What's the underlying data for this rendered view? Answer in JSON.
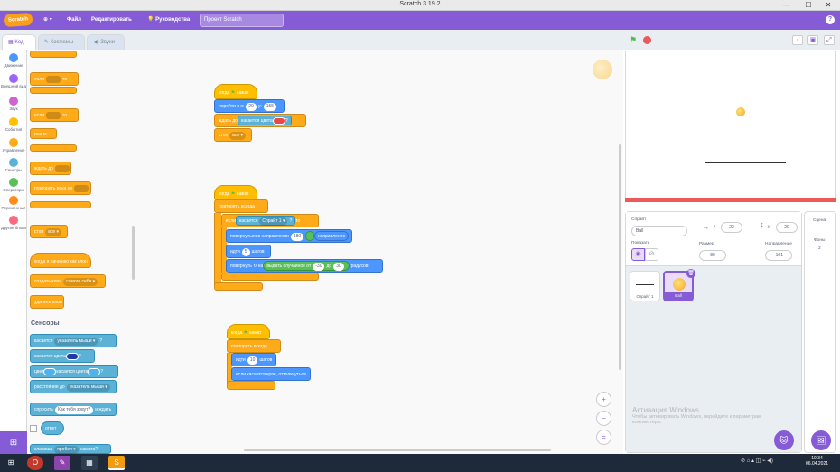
{
  "window": {
    "title": "Scratch 3.19.2",
    "min": "—",
    "max": "☐",
    "close": "✕"
  },
  "menu": {
    "logo": "Scratch",
    "globe": "⊕ ▾",
    "file": "Файл",
    "edit": "Редактировать",
    "tutorials": "Руководства",
    "project_name": "Проект Scratch",
    "help": "?"
  },
  "tabs": {
    "code": "Код",
    "costumes": "Костюмы",
    "sounds": "Звуки"
  },
  "categories": [
    {
      "label": "Движение",
      "color": "#4c97ff"
    },
    {
      "label": "Внешний вид",
      "color": "#9966ff"
    },
    {
      "label": "Звук",
      "color": "#cf63cf"
    },
    {
      "label": "События",
      "color": "#ffbf00"
    },
    {
      "label": "Управление",
      "color": "#ffab19"
    },
    {
      "label": "Сенсоры",
      "color": "#5cb1d6"
    },
    {
      "label": "Операторы",
      "color": "#59c059"
    },
    {
      "label": "Переменные",
      "color": "#ff8c1a"
    },
    {
      "label": "Другие блоки",
      "color": "#ff6680"
    }
  ],
  "palette": {
    "if_then_if": "если",
    "if_then_then": "то",
    "if_else_if": "если",
    "if_else_then": "то",
    "if_else_else": "иначе",
    "wait_until": "ждать до",
    "repeat_until": "повторять пока не",
    "stop": "стоп",
    "stop_opt": "все ▾",
    "clone_start": "когда я начинаю как клон",
    "create_clone": "создать клон",
    "create_clone_opt": "самого себя ▾",
    "delete_clone": "удалить клон",
    "sensing_header": "Сенсоры",
    "touching": "касается",
    "touching_opt": "указатель мыши ▾",
    "touching_q": "?",
    "touching_color": "касается цвета",
    "touching_color_q": "?",
    "color": "цвет",
    "color_touching": "касается цвета",
    "color_q": "?",
    "distance": "расстояние до",
    "distance_opt": "указатель мыши ▾",
    "ask": "спросить",
    "ask_val": "Как тебя зовут?",
    "ask_wait": "и ждать",
    "answer": "ответ",
    "keypressed": "клавиша",
    "keypressed_opt": "пробел ▾",
    "keypressed_tail": "нажата?"
  },
  "scripts": {
    "s1": {
      "hat": "когда",
      "hat2": "нажат",
      "goto": "перейти в x:",
      "x": "20",
      "y_label": "y:",
      "y": "155",
      "wait_until": "ждать до",
      "touching_color": "касается цвета",
      "q": "?",
      "stop": "стоп",
      "stop_opt": "все ▾"
    },
    "s2": {
      "hat": "когда",
      "hat2": "нажат",
      "forever": "повторять всегда",
      "if": "если",
      "touching": "касается",
      "sprite_opt": "Спрайт 1 ▾",
      "q": "?",
      "then": "то",
      "point": "повернуться в направлении",
      "dir_val": "180",
      "minus": "-",
      "direction": "направление",
      "move": "идти",
      "move_val": "5",
      "steps": "шагов",
      "turn": "повернуть",
      "turn_on": "на",
      "random": "выдать случайное от",
      "r_from": "-30",
      "r_to": "до",
      "r_to_val": "30",
      "degrees": "градусов"
    },
    "s3": {
      "hat": "когда",
      "hat2": "нажат",
      "forever": "повторять всегда",
      "move": "идти",
      "move_val": "10",
      "steps": "шагов",
      "bounce": "если касается края, оттолкнуться"
    }
  },
  "zoom": {
    "in": "+",
    "out": "−",
    "reset": "="
  },
  "sprite_info": {
    "sprite_label": "Спрайт",
    "sprite_name": "Ball",
    "x_label": "x",
    "x": "22",
    "y_label": "y",
    "y": "20",
    "show_label": "Показать",
    "size_label": "Размер",
    "size": "80",
    "direction_label": "Направление",
    "direction": "-101"
  },
  "sprites": [
    {
      "name": "Спрайт 1"
    },
    {
      "name": "Ball"
    }
  ],
  "stage_pane": {
    "title": "Сцена",
    "backdrops_label": "Фоны",
    "backdrops": "2"
  },
  "watermark": {
    "line1": "Активация Windows",
    "line2": "Чтобы активировать Windows, перейдите к параметрам",
    "line3": "компьютера."
  },
  "taskbar": {
    "time": "19:34",
    "date": "06.04.2021"
  }
}
